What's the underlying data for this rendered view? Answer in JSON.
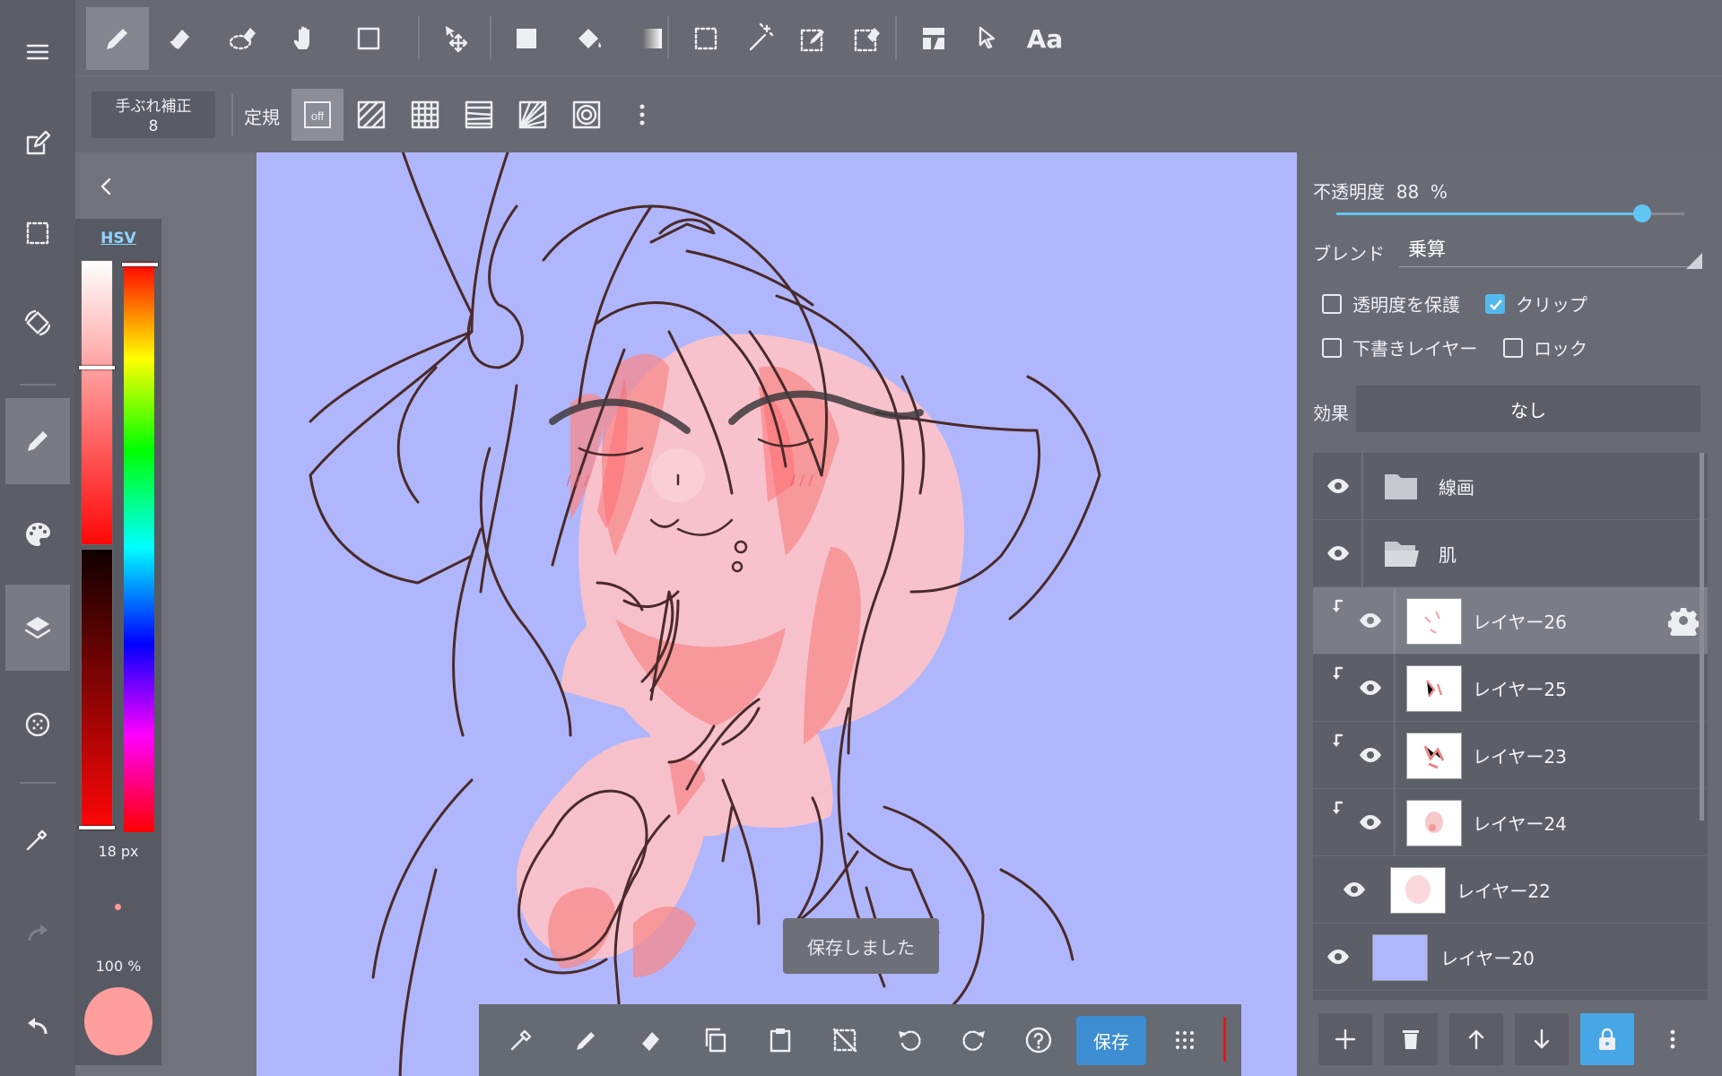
{
  "toolbar": {
    "stabilizer": {
      "label": "手ぶれ補正",
      "value": "8"
    },
    "ruler_label": "定規",
    "ruler_off": "off",
    "text_tool": "Aa",
    "tools": [
      "pen-icon",
      "eraser-icon",
      "lasso-eraser-icon",
      "hand-icon",
      "shape-icon",
      "move-icon",
      "fill-square-icon",
      "bucket-icon",
      "gradient-icon",
      "select-rect-icon",
      "magic-wand-icon",
      "select-pen-icon",
      "select-eraser-icon",
      "frame-icon",
      "pointer-icon",
      "text-icon"
    ]
  },
  "rail": [
    "menu-icon",
    "edit-icon",
    "selection-icon",
    "rotate-icon",
    "brush-icon",
    "palette-icon",
    "layers-icon",
    "material-icon",
    "eyedropper-icon",
    "redo-icon",
    "undo-icon"
  ],
  "color": {
    "mode": "HSV",
    "brush_size": "18 px",
    "opacity": "100 %",
    "current": "#ff9e9c"
  },
  "layer_props": {
    "opacity_label": "不透明度",
    "opacity_value": "88",
    "opacity_unit": "%",
    "opacity_fraction": 0.88,
    "blend_label": "ブレンド",
    "blend_value": "乗算",
    "protect_alpha": "透明度を保護",
    "clip": "クリップ",
    "draft_layer": "下書きレイヤー",
    "lock": "ロック",
    "effect_label": "効果",
    "effect_value": "なし"
  },
  "layers": [
    {
      "name": "線画",
      "type": "folder"
    },
    {
      "name": "肌",
      "type": "folder"
    },
    {
      "name": "レイヤー26",
      "type": "layer",
      "clipped": true,
      "selected": true
    },
    {
      "name": "レイヤー25",
      "type": "layer",
      "clipped": true
    },
    {
      "name": "レイヤー23",
      "type": "layer",
      "clipped": true
    },
    {
      "name": "レイヤー24",
      "type": "layer",
      "clipped": true
    },
    {
      "name": "レイヤー22",
      "type": "layer"
    },
    {
      "name": "レイヤー20",
      "type": "layer",
      "fill": "#b0b6fc"
    }
  ],
  "toast": "保存しました",
  "bottom": {
    "save_label": "保存"
  },
  "colors": {
    "accent": "#53b9ec",
    "canvas_bg": "#b0b6fc",
    "save": "#3d8ed2"
  }
}
